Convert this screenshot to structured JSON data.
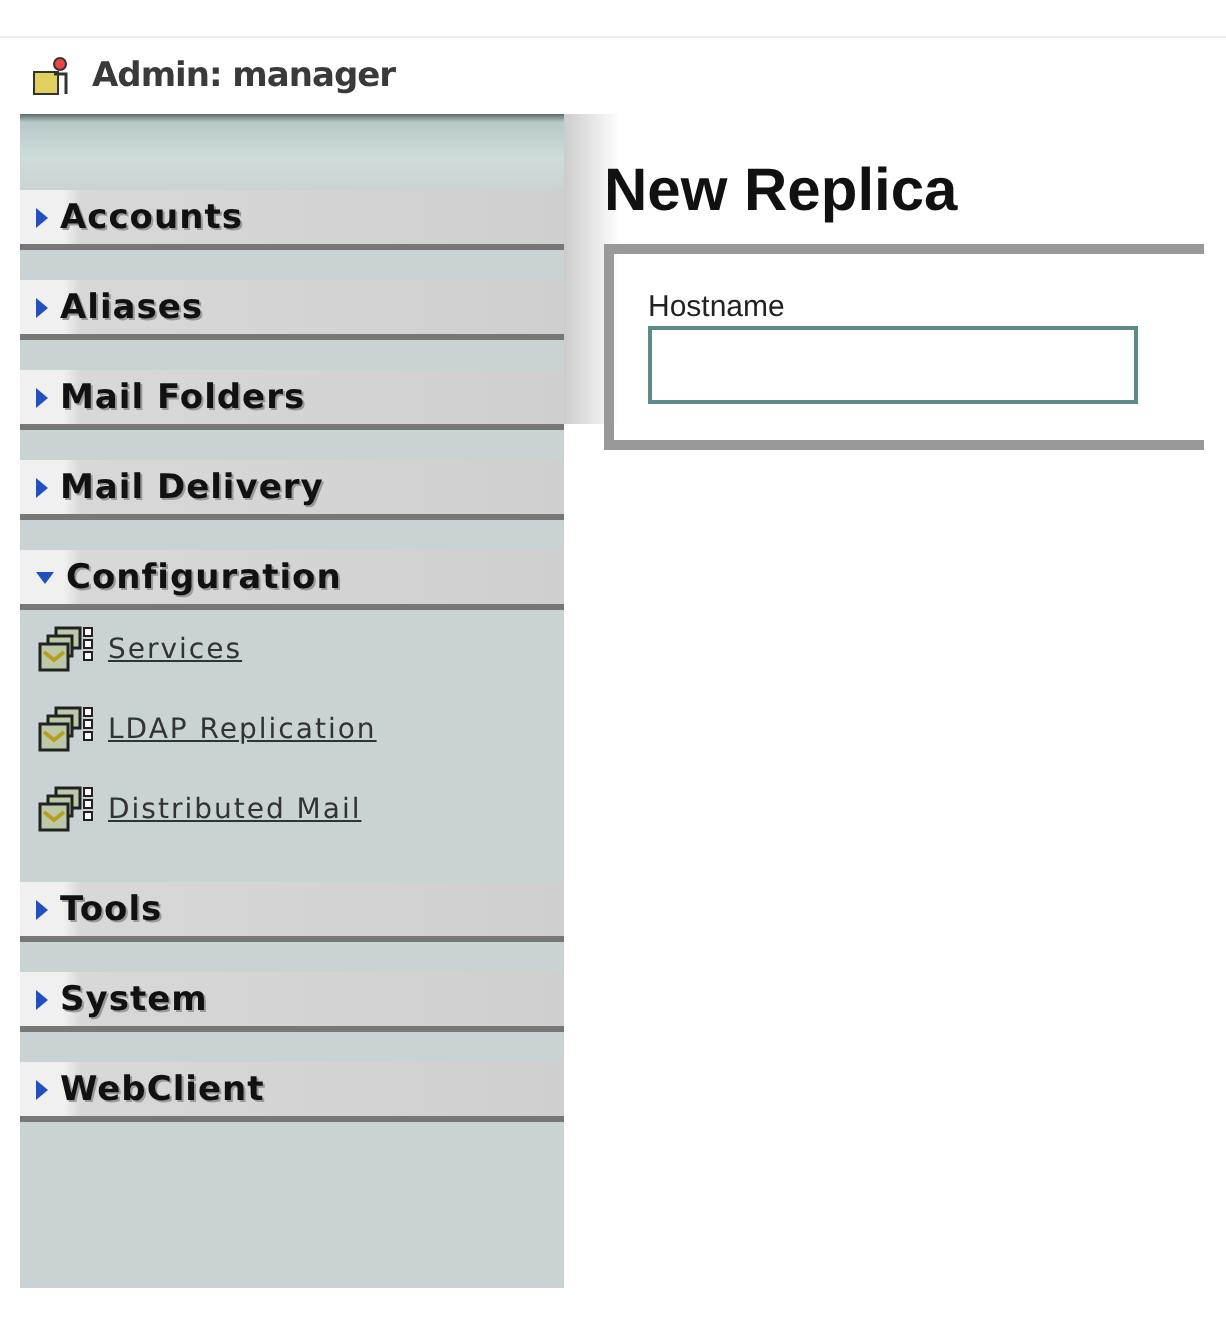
{
  "header": {
    "title": "Admin: manager"
  },
  "sections": [
    {
      "label": "Accounts",
      "expanded": false
    },
    {
      "label": "Aliases",
      "expanded": false
    },
    {
      "label": "Mail Folders",
      "expanded": false
    },
    {
      "label": "Mail Delivery",
      "expanded": false
    },
    {
      "label": "Configuration",
      "expanded": true,
      "items": [
        {
          "label": "Services"
        },
        {
          "label": "LDAP Replication"
        },
        {
          "label": "Distributed Mail"
        }
      ]
    },
    {
      "label": "Tools",
      "expanded": false
    },
    {
      "label": "System",
      "expanded": false
    },
    {
      "label": "WebClient",
      "expanded": false
    }
  ],
  "main": {
    "title": "New Replica",
    "form": {
      "field_label": "Hostname"
    }
  }
}
